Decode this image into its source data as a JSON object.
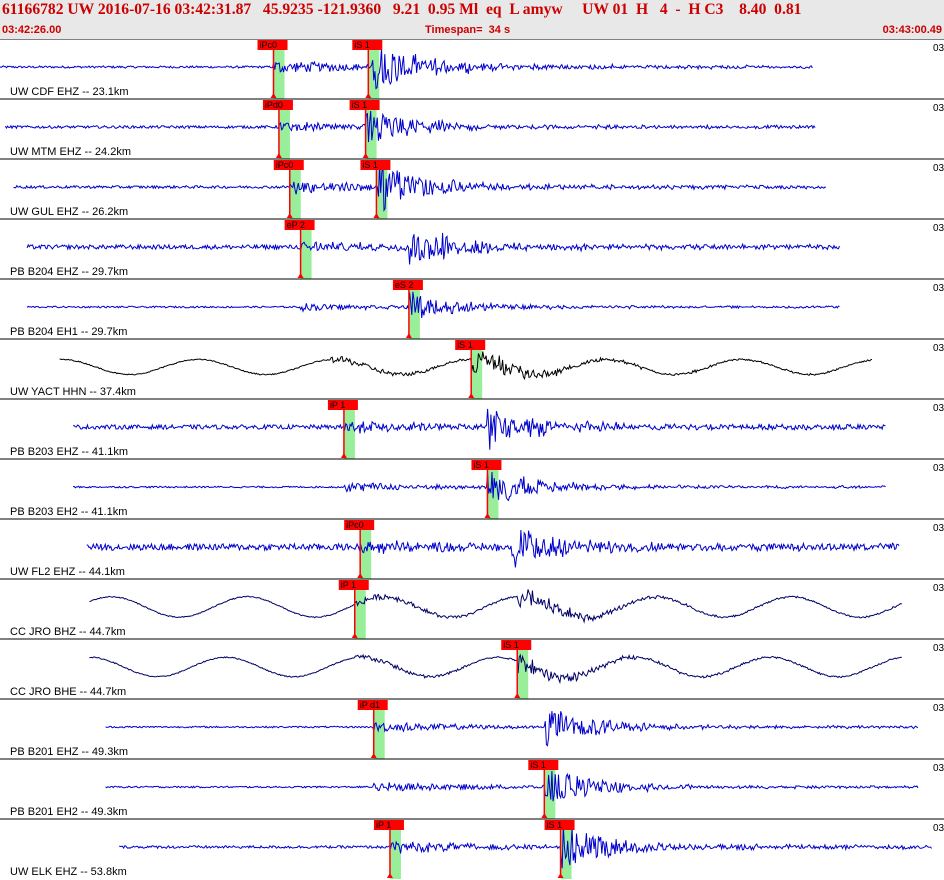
{
  "header": {
    "title_line": "61166782 UW 2016-07-16 03:42:31.87   45.9235 -121.9360   9.21  0.95 Ml  eq  L amyw     UW 01  H   4  -  H C3    8.40  0.81",
    "start_time": "03:42:26.00",
    "timespan": "Timespan=  34 s",
    "end_time": "03:43:00.49"
  },
  "colors": {
    "header_bg": "#e8e8e8",
    "header_text": "#cc0000",
    "trace_blue": "#0000cc",
    "trace_black": "#000000",
    "trace_navy": "#000066",
    "pick_red": "#ff0000",
    "pick_window_green": "#99ee99"
  },
  "chart_data": {
    "type": "line",
    "xlabel": "",
    "ylabel": "",
    "time_range_s": [
      0,
      34.49
    ],
    "edge_label": "03",
    "traces": [
      {
        "label": "UW CDF EHZ -- 23.1km",
        "color": "blue",
        "start_s": 0.0,
        "end_s": 30.0,
        "noise": 0.04,
        "picks": [
          {
            "label": "iPc0",
            "t": 10.1
          },
          {
            "label": "iS 1",
            "t": 13.6
          }
        ],
        "arrival_s": 10.1,
        "s_arrival_s": 13.6,
        "amp": 0.95,
        "low_freq": 0.0
      },
      {
        "label": "UW MTM EHZ -- 24.2km",
        "color": "blue",
        "start_s": 0.2,
        "end_s": 30.1,
        "noise": 0.05,
        "picks": [
          {
            "label": "iPd0",
            "t": 10.3
          },
          {
            "label": "iS 1",
            "t": 13.5
          }
        ],
        "arrival_s": 10.3,
        "s_arrival_s": 13.5,
        "amp": 0.7,
        "low_freq": 0.0
      },
      {
        "label": "UW GUL EHZ -- 26.2km",
        "color": "blue",
        "start_s": 0.5,
        "end_s": 30.5,
        "noise": 0.05,
        "picks": [
          {
            "label": "iPc0",
            "t": 10.7
          },
          {
            "label": "iS 1",
            "t": 13.9
          }
        ],
        "arrival_s": 10.7,
        "s_arrival_s": 13.9,
        "amp": 0.95,
        "low_freq": 0.0
      },
      {
        "label": "PB B204 EHZ -- 29.7km",
        "color": "blue",
        "start_s": 1.0,
        "end_s": 31.0,
        "noise": 0.08,
        "picks": [
          {
            "label": "eP 2",
            "t": 11.1
          }
        ],
        "arrival_s": 11.1,
        "s_arrival_s": 15.1,
        "amp": 0.75,
        "low_freq": 0.0
      },
      {
        "label": "PB B204 EH1 -- 29.7km",
        "color": "blue",
        "start_s": 1.0,
        "end_s": 31.0,
        "noise": 0.03,
        "picks": [
          {
            "label": "eS 2",
            "t": 15.1
          }
        ],
        "arrival_s": 11.1,
        "s_arrival_s": 15.1,
        "amp": 0.55,
        "low_freq": 0.0
      },
      {
        "label": "UW YACT HHN -- 37.4km",
        "color": "black",
        "start_s": 2.2,
        "end_s": 32.2,
        "noise": 0.02,
        "picks": [
          {
            "label": "iS 1",
            "t": 17.4
          }
        ],
        "arrival_s": 12.2,
        "s_arrival_s": 17.4,
        "amp": 0.55,
        "low_freq": 0.28
      },
      {
        "label": "PB B203 EHZ -- 41.1km",
        "color": "blue",
        "start_s": 2.7,
        "end_s": 32.7,
        "noise": 0.08,
        "picks": [
          {
            "label": "iP 1",
            "t": 12.7
          }
        ],
        "arrival_s": 12.7,
        "s_arrival_s": 18.0,
        "amp": 0.8,
        "low_freq": 0.0
      },
      {
        "label": "PB B203 EH2 -- 41.1km",
        "color": "blue",
        "start_s": 2.7,
        "end_s": 32.7,
        "noise": 0.03,
        "picks": [
          {
            "label": "iS 1",
            "t": 18.0
          }
        ],
        "arrival_s": 12.7,
        "s_arrival_s": 18.0,
        "amp": 0.7,
        "low_freq": 0.0
      },
      {
        "label": "UW FL2 EHZ -- 44.1km",
        "color": "blue",
        "start_s": 3.2,
        "end_s": 33.2,
        "noise": 0.12,
        "picks": [
          {
            "label": "iPc0",
            "t": 13.3
          }
        ],
        "arrival_s": 13.3,
        "s_arrival_s": 18.9,
        "amp": 0.85,
        "low_freq": 0.0
      },
      {
        "label": "CC JRO BHZ -- 44.7km",
        "color": "navy",
        "start_s": 3.3,
        "end_s": 33.3,
        "noise": 0.02,
        "picks": [
          {
            "label": "iP 1",
            "t": 13.1
          }
        ],
        "arrival_s": 13.1,
        "s_arrival_s": 19.1,
        "amp": 0.5,
        "low_freq": 0.38
      },
      {
        "label": "CC JRO BHE -- 44.7km",
        "color": "navy",
        "start_s": 3.3,
        "end_s": 33.3,
        "noise": 0.02,
        "picks": [
          {
            "label": "iS 1",
            "t": 19.1
          }
        ],
        "arrival_s": 13.1,
        "s_arrival_s": 19.1,
        "amp": 0.45,
        "low_freq": 0.36
      },
      {
        "label": "PB B201 EHZ -- 49.3km",
        "color": "blue",
        "start_s": 3.9,
        "end_s": 33.9,
        "noise": 0.03,
        "picks": [
          {
            "label": "iP d1",
            "t": 13.8
          }
        ],
        "arrival_s": 13.8,
        "s_arrival_s": 20.1,
        "amp": 0.75,
        "low_freq": 0.0
      },
      {
        "label": "PB B201 EH2 -- 49.3km",
        "color": "blue",
        "start_s": 3.9,
        "end_s": 33.9,
        "noise": 0.03,
        "picks": [
          {
            "label": "iS 1",
            "t": 20.1
          }
        ],
        "arrival_s": 13.8,
        "s_arrival_s": 20.1,
        "amp": 0.75,
        "low_freq": 0.0
      },
      {
        "label": "UW ELK EHZ -- 53.8km",
        "color": "blue",
        "start_s": 4.4,
        "end_s": 34.4,
        "noise": 0.05,
        "picks": [
          {
            "label": "iP 1",
            "t": 14.4
          },
          {
            "label": "iS 1",
            "t": 20.7
          }
        ],
        "arrival_s": 14.4,
        "s_arrival_s": 20.7,
        "amp": 0.9,
        "low_freq": 0.0
      }
    ]
  }
}
